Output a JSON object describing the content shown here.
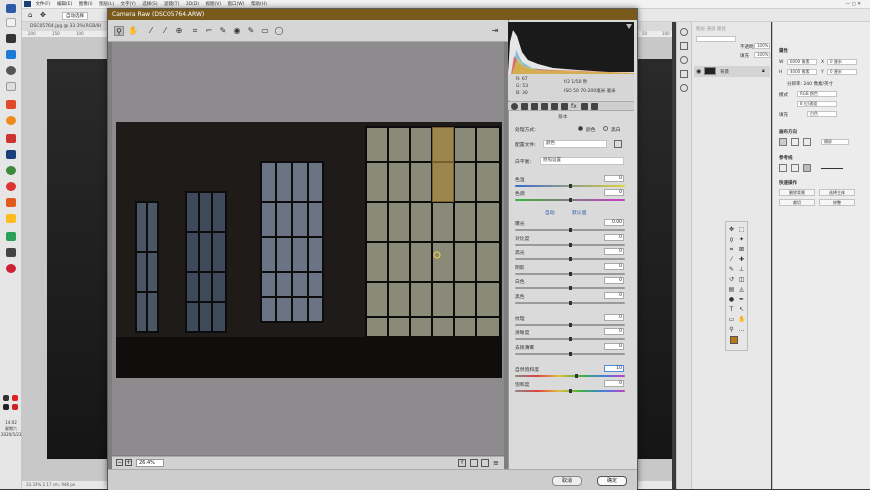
{
  "taskbar": {
    "time": "14:02",
    "day": "星期六",
    "date": "2020/5/23"
  },
  "ps": {
    "menus": [
      "文件(F)",
      "编辑(E)",
      "图像(I)",
      "图层(L)",
      "文字(Y)",
      "选择(S)",
      "滤镜(T)",
      "3D(D)",
      "视图(V)",
      "窗口(W)",
      "帮助(H)"
    ],
    "options_label": "自动选择",
    "doc_tab": "DSC05764.jpg @ 33.3%(RGB/8)",
    "ruler_ticks": [
      "200",
      "150",
      "100",
      "50",
      "0",
      "50",
      "100"
    ],
    "status": "33.33%  2.17 cm, 948 px",
    "layers": {
      "layer_name": "背景",
      "opacity_label": "不透明度",
      "opacity": "100%",
      "fill_label": "填充",
      "fill": "100%"
    },
    "props": {
      "title": "属性",
      "w_label": "W",
      "w": "6000 像素",
      "h_label": "H",
      "h": "4000 像素",
      "x_label": "X",
      "x": "0 厘米",
      "y_label": "Y",
      "y": "0 厘米",
      "resolution": "分辨率: 240 像素/英寸",
      "mode_label": "模式",
      "mode": "RGB 颜色",
      "bits": "8 位/通道",
      "fill_label": "填充",
      "fill": "白色",
      "canvas_label": "画布方向",
      "orient": "横屏",
      "guides_label": "参考线",
      "quick_label": "快速操作",
      "btn_remove_bg": "删除背景",
      "btn_select_subject": "选择主体",
      "btn_crop": "裁切",
      "btn_trim": "修整"
    }
  },
  "acr": {
    "title": "Camera Raw (DSC05764.ARW)",
    "info": {
      "r": "R:  67",
      "g": "G:  53",
      "b": "B:  30",
      "shot1": "f/2  1/50 秒",
      "shot2": "ISO 50  70-200毫米 毫米"
    },
    "panel_title": "基本",
    "process_label": "处理方式:",
    "process_color": "颜色",
    "process_bw": "黑白",
    "profile_label": "配置文件:",
    "profile": "颜色",
    "wb_label": "白平衡:",
    "wb": "原照设置",
    "auto": "自动",
    "default": "默认值",
    "sliders": [
      {
        "name": "temp",
        "label": "色温",
        "value": "0",
        "pos": 0.5
      },
      {
        "name": "tint",
        "label": "色调",
        "value": "0",
        "pos": 0.5
      },
      {
        "name": "exposure",
        "label": "曝光",
        "value": "0.00",
        "pos": 0.5
      },
      {
        "name": "contrast",
        "label": "对比度",
        "value": "0",
        "pos": 0.5
      },
      {
        "name": "highlights",
        "label": "高光",
        "value": "0",
        "pos": 0.5
      },
      {
        "name": "shadows",
        "label": "阴影",
        "value": "0",
        "pos": 0.5
      },
      {
        "name": "whites",
        "label": "白色",
        "value": "0",
        "pos": 0.5
      },
      {
        "name": "blacks",
        "label": "黑色",
        "value": "0",
        "pos": 0.5
      },
      {
        "name": "texture",
        "label": "纹理",
        "value": "0",
        "pos": 0.5
      },
      {
        "name": "clarity",
        "label": "清晰度",
        "value": "0",
        "pos": 0.5
      },
      {
        "name": "dehaze",
        "label": "去除薄雾",
        "value": "0",
        "pos": 0.5
      },
      {
        "name": "vibrance",
        "label": "自然饱和度",
        "value": "10",
        "pos": 0.55
      },
      {
        "name": "saturation",
        "label": "饱和度",
        "value": "0",
        "pos": 0.5
      }
    ],
    "zoom": "26.4%",
    "cancel": "取消",
    "ok": "确定"
  }
}
